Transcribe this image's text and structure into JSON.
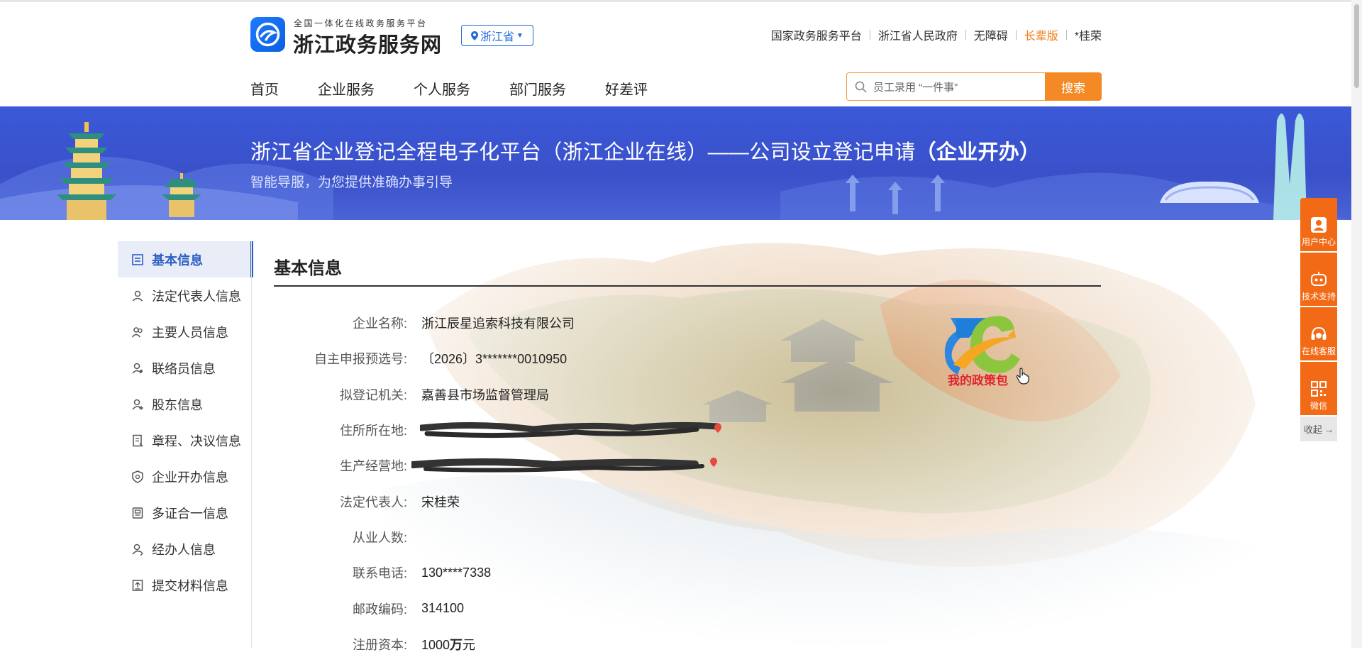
{
  "header": {
    "logo_subtitle": "全国一体化在线政务服务平台",
    "logo_title": "浙江政务服务网",
    "region": "浙江省",
    "top_links": [
      "国家政务服务平台",
      "浙江省人民政府",
      "无障碍"
    ],
    "elder_mode": "长辈版",
    "user": "*桂荣"
  },
  "nav": [
    "首页",
    "企业服务",
    "个人服务",
    "部门服务",
    "好差评"
  ],
  "search": {
    "placeholder": "员工录用 “一件事”",
    "button": "搜索"
  },
  "banner": {
    "title": "浙江省企业登记全程电子化平台（浙江企业在线）——公司设立登记申请",
    "title_bold": "（企业开办）",
    "subtitle": "智能导服，为您提供准确办事引导"
  },
  "sidebar": {
    "items": [
      {
        "label": "基本信息",
        "icon": "doc-list-icon"
      },
      {
        "label": "法定代表人信息",
        "icon": "person-icon"
      },
      {
        "label": "主要人员信息",
        "icon": "people-icon"
      },
      {
        "label": "联络员信息",
        "icon": "contact-icon"
      },
      {
        "label": "股东信息",
        "icon": "shareholder-icon"
      },
      {
        "label": "章程、决议信息",
        "icon": "document-icon"
      },
      {
        "label": "企业开办信息",
        "icon": "shield-icon"
      },
      {
        "label": "多证合一信息",
        "icon": "certificate-icon"
      },
      {
        "label": "经办人信息",
        "icon": "agent-icon"
      },
      {
        "label": "提交材料信息",
        "icon": "upload-icon"
      }
    ]
  },
  "section": {
    "title": "基本信息"
  },
  "fields": {
    "company_name": {
      "label": "企业名称:",
      "value": "浙江辰星追索科技有限公司"
    },
    "prename_no": {
      "label": "自主申报预选号:",
      "value": "〔2026〕3*******0010950"
    },
    "reg_authority": {
      "label": "拟登记机关:",
      "value": "嘉善县市场监督管理局"
    },
    "address": {
      "label": "住所所在地:"
    },
    "business_place": {
      "label": "生产经营地:"
    },
    "legal_rep": {
      "label": "法定代表人:",
      "value": "宋桂荣"
    },
    "employees": {
      "label": "从业人数:",
      "value": ""
    },
    "phone": {
      "label": "联系电话:",
      "value": "130****7338"
    },
    "postcode": {
      "label": "邮政编码:",
      "value": "314100"
    },
    "capital": {
      "label": "注册资本:",
      "value": "1000",
      "unit": "万",
      "suffix": "元"
    }
  },
  "policy_badge": {
    "label": "我的政策包",
    "logo": "ZC"
  },
  "float_bar": {
    "items": [
      {
        "label": "用户中心",
        "icon": "user-icon"
      },
      {
        "label": "技术支持",
        "icon": "robot-icon"
      },
      {
        "label": "在线客服",
        "icon": "headset-icon"
      },
      {
        "label": "微信",
        "icon": "qrcode-icon"
      }
    ],
    "collapse": "收起 →"
  },
  "colors": {
    "brand_blue": "#2f5fc4",
    "accent_orange": "#f38a25",
    "banner_blue": "#3a50c9"
  }
}
